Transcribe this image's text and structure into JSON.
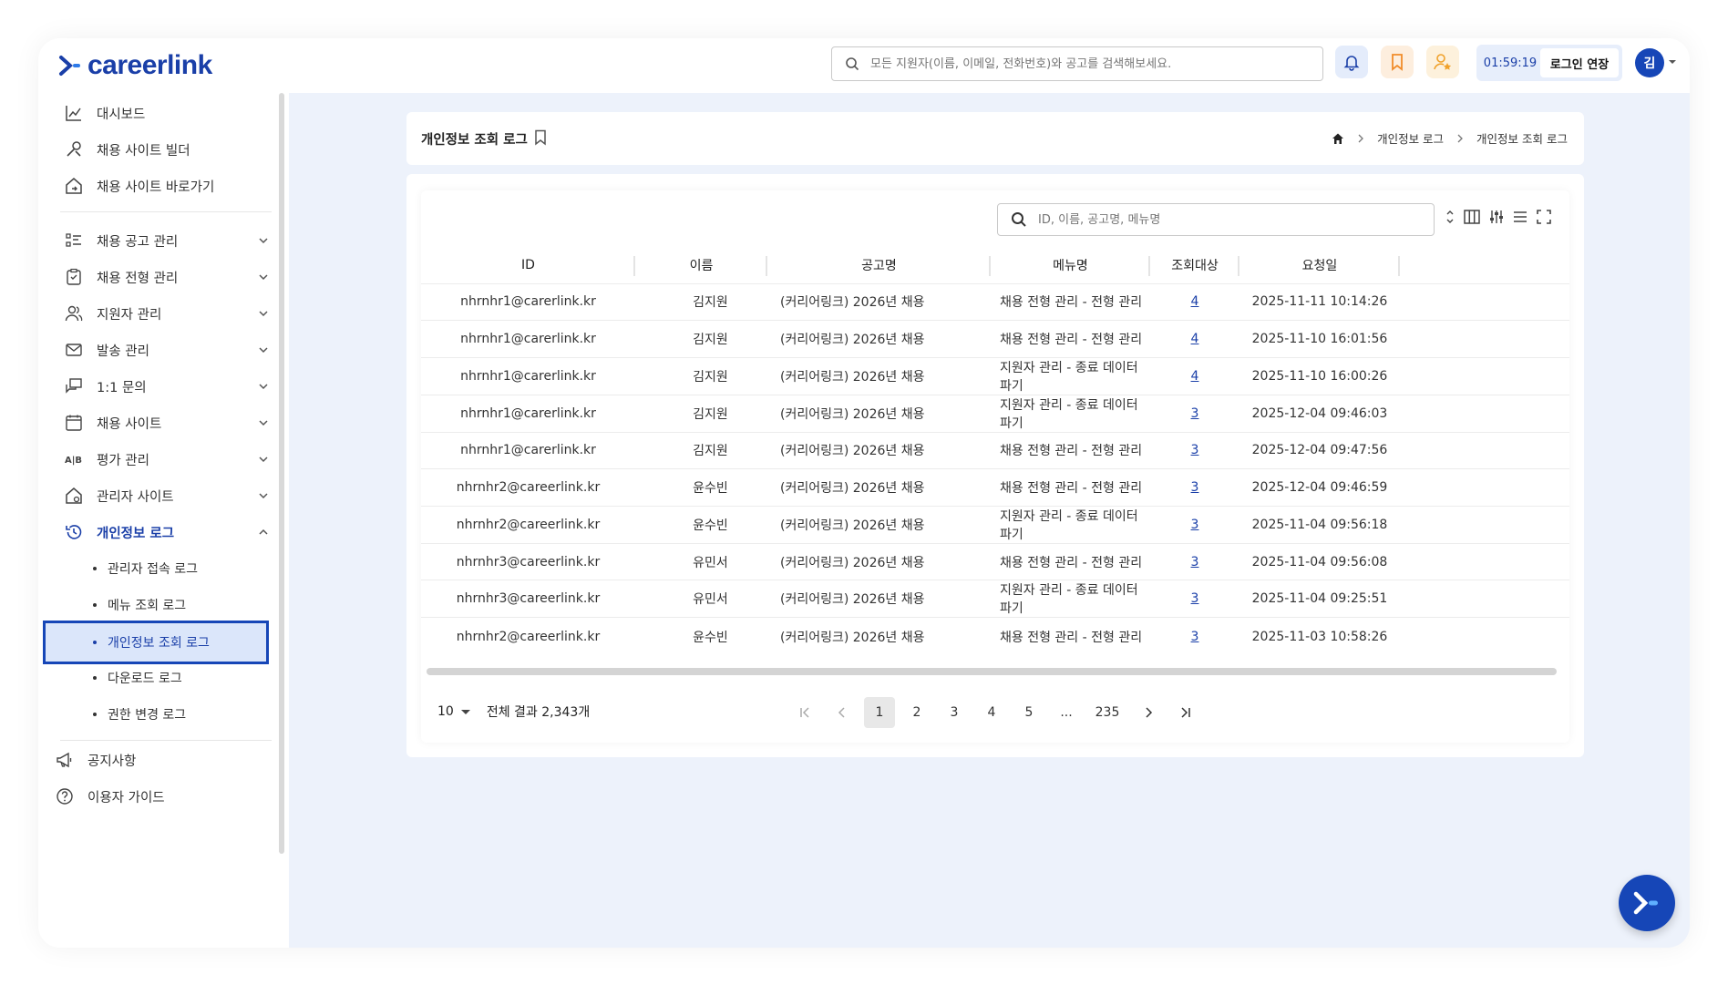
{
  "brand": {
    "logo_text": "careerlink"
  },
  "header": {
    "search_placeholder": "모든 지원자(이름, 이메일, 전화번호)와 공고를 검색해보세요.",
    "timer": "01:59:19",
    "extend_label": "로그인 연장",
    "avatar": "김"
  },
  "sidebar": {
    "items": [
      {
        "label": "대시보드"
      },
      {
        "label": "채용 사이트 빌더"
      },
      {
        "label": "채용 사이트 바로가기"
      },
      {
        "label": "채용 공고 관리"
      },
      {
        "label": "채용 전형 관리"
      },
      {
        "label": "지원자 관리"
      },
      {
        "label": "발송 관리"
      },
      {
        "label": "1:1 문의"
      },
      {
        "label": "채용 사이트"
      },
      {
        "label": "평가 관리"
      },
      {
        "label": "관리자 사이트"
      },
      {
        "label": "개인정보 로그"
      }
    ],
    "sub_items": [
      {
        "label": "관리자 접속 로그"
      },
      {
        "label": "메뉴 조회 로그"
      },
      {
        "label": "개인정보 조회 로그"
      },
      {
        "label": "다운로드 로그"
      },
      {
        "label": "권한 변경 로그"
      }
    ],
    "bottom": [
      {
        "label": "공지사항"
      },
      {
        "label": "이용자 가이드"
      }
    ]
  },
  "page": {
    "title": "개인정보 조회 로그",
    "breadcrumb": [
      "개인정보 로그",
      "개인정보 조회 로그"
    ]
  },
  "table": {
    "search_placeholder": "ID, 이름, 공고명, 메뉴명",
    "columns": [
      "ID",
      "이름",
      "공고명",
      "메뉴명",
      "조회대상",
      "요청일"
    ],
    "rows": [
      {
        "id": "nhrnhr1@carerlink.kr",
        "name": "김지원",
        "posting": "(커리어링크) 2026년 채용",
        "menu": "채용 전형 관리 - 전형 관리",
        "count": "4",
        "date": "2025-11-11 10:14:26"
      },
      {
        "id": "nhrnhr1@carerlink.kr",
        "name": "김지원",
        "posting": "(커리어링크) 2026년 채용",
        "menu": "채용 전형 관리 - 전형 관리",
        "count": "4",
        "date": "2025-11-10 16:01:56"
      },
      {
        "id": "nhrnhr1@carerlink.kr",
        "name": "김지원",
        "posting": "(커리어링크) 2026년 채용",
        "menu": "지원자 관리 - 종료 데이터 파기",
        "count": "4",
        "date": "2025-11-10 16:00:26"
      },
      {
        "id": "nhrnhr1@carerlink.kr",
        "name": "김지원",
        "posting": "(커리어링크) 2026년 채용",
        "menu": "지원자 관리 - 종료 데이터 파기",
        "count": "3",
        "date": "2025-12-04 09:46:03"
      },
      {
        "id": "nhrnhr1@carerlink.kr",
        "name": "김지원",
        "posting": "(커리어링크) 2026년 채용",
        "menu": "채용 전형 관리 - 전형 관리",
        "count": "3",
        "date": "2025-12-04 09:47:56"
      },
      {
        "id": "nhrnhr2@careerlink.kr",
        "name": "윤수빈",
        "posting": "(커리어링크) 2026년 채용",
        "menu": "채용 전형 관리 - 전형 관리",
        "count": "3",
        "date": "2025-12-04 09:46:59"
      },
      {
        "id": "nhrnhr2@careerlink.kr",
        "name": "윤수빈",
        "posting": "(커리어링크) 2026년 채용",
        "menu": "지원자 관리 - 종료 데이터 파기",
        "count": "3",
        "date": "2025-11-04 09:56:18"
      },
      {
        "id": "nhrnhr3@careerlink.kr",
        "name": "유민서",
        "posting": "(커리어링크) 2026년 채용",
        "menu": "채용 전형 관리 - 전형 관리",
        "count": "3",
        "date": "2025-11-04 09:56:08"
      },
      {
        "id": "nhrnhr3@careerlink.kr",
        "name": "유민서",
        "posting": "(커리어링크) 2026년 채용",
        "menu": "지원자 관리 - 종료 데이터 파기",
        "count": "3",
        "date": "2025-11-04 09:25:51"
      },
      {
        "id": "nhrnhr2@careerlink.kr",
        "name": "윤수빈",
        "posting": "(커리어링크) 2026년 채용",
        "menu": "채용 전형 관리 - 전형 관리",
        "count": "3",
        "date": "2025-11-03 10:58:26"
      }
    ]
  },
  "pagination": {
    "page_size": "10",
    "total_text": "전체 결과 2,343개",
    "pages": [
      "1",
      "2",
      "3",
      "4",
      "5",
      "...",
      "235"
    ],
    "current": "1"
  },
  "colors": {
    "primary": "#1646b7",
    "background": "#edf2fb"
  }
}
